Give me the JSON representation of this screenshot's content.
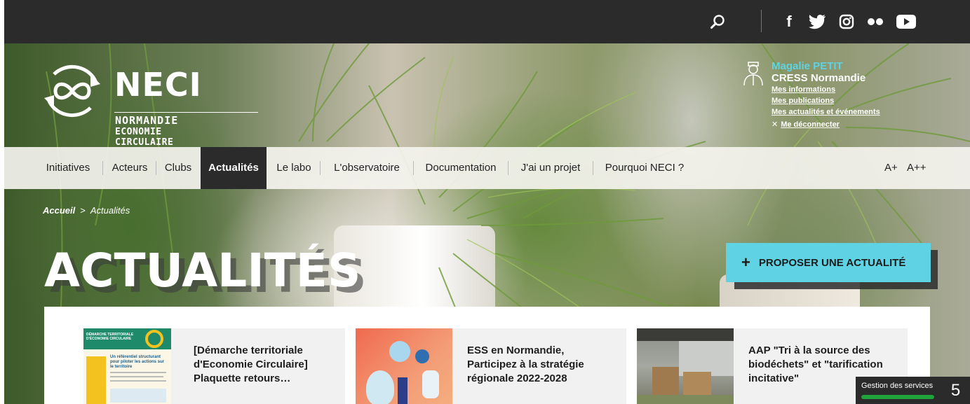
{
  "topbar": {
    "icons": [
      "search-icon",
      "facebook-icon",
      "twitter-icon",
      "instagram-icon",
      "flickr-icon",
      "youtube-icon"
    ]
  },
  "logo": {
    "name": "NECI",
    "line1": "NORMANDIE",
    "line2": "ECONOMIE CIRCULAIRE"
  },
  "user": {
    "name": "Magalie PETIT",
    "org": "CRESS Normandie",
    "links": [
      "Mes informations",
      "Mes publications",
      "Mes actualités et événements"
    ],
    "logout": "Me déconnecter"
  },
  "nav": {
    "items": [
      "Initiatives",
      "Acteurs",
      "Clubs",
      "Actualités",
      "Le labo",
      "L'observatoire",
      "Documentation",
      "J'ai un projet",
      "Pourquoi NECI ?"
    ],
    "active": "Actualités",
    "font_small": "A+",
    "font_large": "A++"
  },
  "breadcrumb": {
    "home": "Accueil",
    "separator": ">",
    "current": "Actualités"
  },
  "page_title": "ACTUALITÉS",
  "propose_button": "PROPOSER UNE ACTUALITÉ",
  "news": [
    {
      "title": "[Démarche territoriale d'Economie Circulaire] Plaquette retours…"
    },
    {
      "title": "ESS en Normandie, Participez à la stratégie régionale 2022-2028"
    },
    {
      "title": "AAP \"Tri à la source des biodéchets\" et \"tarification incitative\""
    }
  ],
  "thumb1": {
    "heading": "DÉMARCHE TERRITORIALE D'ÉCONOMIE CIRCULAIRE",
    "subheading": "Un référentiel structurant pour piloter les actions sur le territoire"
  },
  "cookie_widget": {
    "label": "Gestion des services",
    "count": "5"
  },
  "colors": {
    "accent": "#5fd3e3",
    "dark": "#2b2b2b",
    "nav_bg": "#f4f3ee"
  }
}
